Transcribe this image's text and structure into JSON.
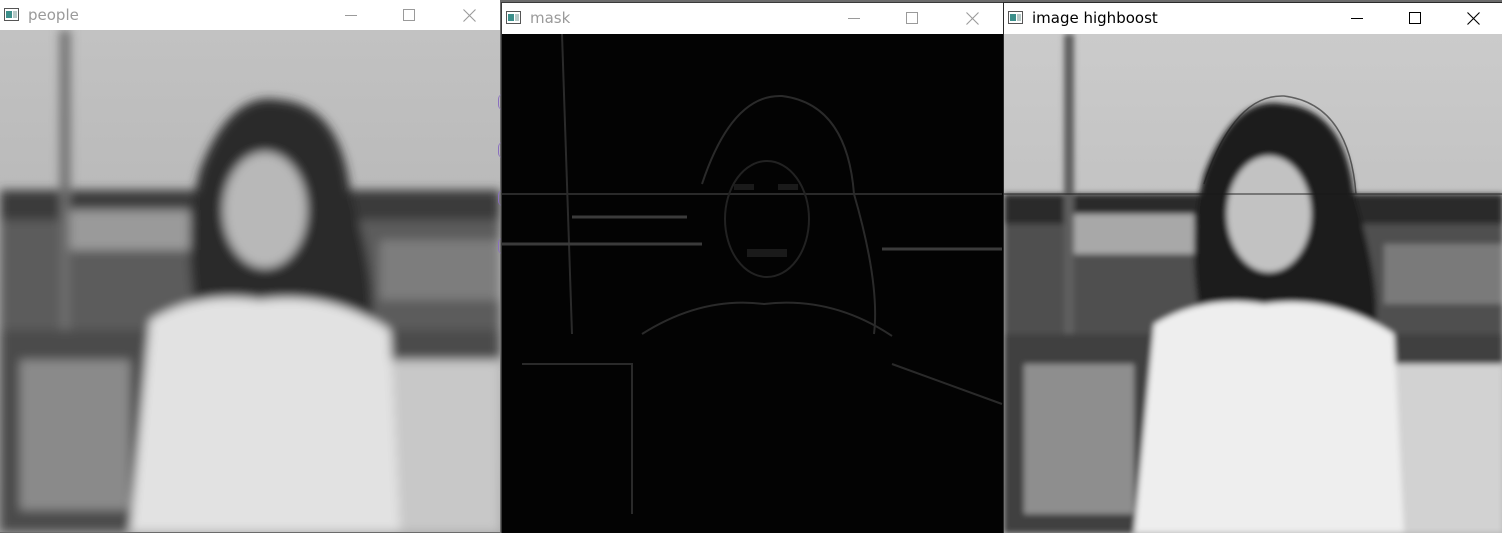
{
  "windows": [
    {
      "title": "people",
      "title_color": "#9a9a9a",
      "controls": [
        "minimize-icon",
        "maximize-icon",
        "close-icon"
      ]
    },
    {
      "title": "mask",
      "title_color": "#9a9a9a",
      "controls": [
        "minimize-icon",
        "maximize-icon",
        "close-icon"
      ]
    },
    {
      "title": "image highboost",
      "title_color": "#000000",
      "controls": [
        "minimize-icon",
        "maximize-icon",
        "close-icon"
      ]
    }
  ]
}
